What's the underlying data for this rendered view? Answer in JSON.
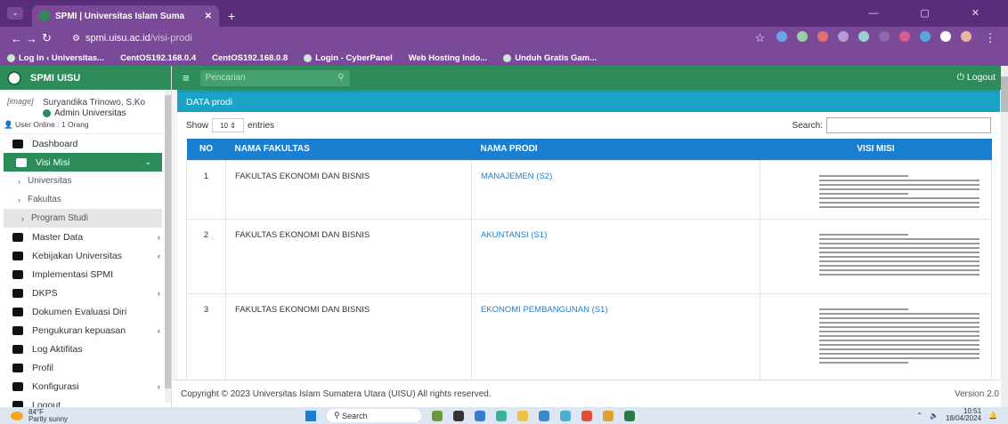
{
  "browser": {
    "tab_title": "SPMI | Universitas Islam Suma",
    "tab_close": "✕",
    "new_tab": "+",
    "url_host": "spmi.uisu.ac.id",
    "url_path": "/visi-prodi",
    "window_controls": "— ▢ ✕",
    "bookmarks": [
      "Log In ‹ Universitas...",
      "CentOS192.168.0.4",
      "CentOS192.168.0.8",
      "Login - CyberPanel",
      "Web Hosting Indo...",
      "Unduh Gratis Gam..."
    ]
  },
  "app": {
    "brand": "SPMI UISU",
    "search_placeholder": "Pencarian",
    "logout_top": "Logout"
  },
  "user": {
    "avatar_alt": "[image]",
    "name": "Suryandika Trinowo, S.Ko",
    "role": "Admin Universitas",
    "online": "User Online : 1 Orang"
  },
  "sidebar": {
    "items": [
      {
        "label": "Dashboard"
      },
      {
        "label": "Visi Misi"
      },
      {
        "label": "Master Data"
      },
      {
        "label": "Kebijakan Universitas"
      },
      {
        "label": "Implementasi SPMI"
      },
      {
        "label": "DKPS"
      },
      {
        "label": "Dokumen Evaluasi Diri"
      },
      {
        "label": "Pengukuran kepuasan"
      },
      {
        "label": "Log Aktifitas"
      },
      {
        "label": "Profil"
      },
      {
        "label": "Konfigurasi"
      },
      {
        "label": "Logout"
      }
    ],
    "sub_items": [
      {
        "label": "Universitas"
      },
      {
        "label": "Fakultas"
      },
      {
        "label": "Program Studi"
      }
    ]
  },
  "panel": {
    "title": "DATA prodi",
    "show_label": "Show",
    "entries_value": "10",
    "entries_label": "entries",
    "search_label": "Search:"
  },
  "table": {
    "headers": [
      "NO",
      "NAMA FAKULTAS",
      "NAMA PRODI",
      "VISI MISI"
    ],
    "rows": [
      {
        "no": "1",
        "fakultas": "FAKULTAS EKONOMI DAN BISNIS",
        "prodi": "MANAJEMEN (S2)"
      },
      {
        "no": "2",
        "fakultas": "FAKULTAS EKONOMI DAN BISNIS",
        "prodi": "AKUNTANSI (S1)"
      },
      {
        "no": "3",
        "fakultas": "FAKULTAS EKONOMI DAN BISNIS",
        "prodi": "EKONOMI PEMBANGUNAN (S1)"
      }
    ]
  },
  "footer": {
    "copyright": "Copyright © 2023 Universitas Islam Sumatera Utara (UISU) All rights reserved.",
    "version": "Version 2.0"
  },
  "taskbar": {
    "temp": "84°F",
    "weather": "Partly sunny",
    "search": "Search",
    "time": "10:51",
    "date": "18/04/2024"
  },
  "colors": {
    "green": "#2d8c5a",
    "teal": "#1aa3c6",
    "blue": "#1a7fd0",
    "browser_purple": "#7a4a98"
  }
}
